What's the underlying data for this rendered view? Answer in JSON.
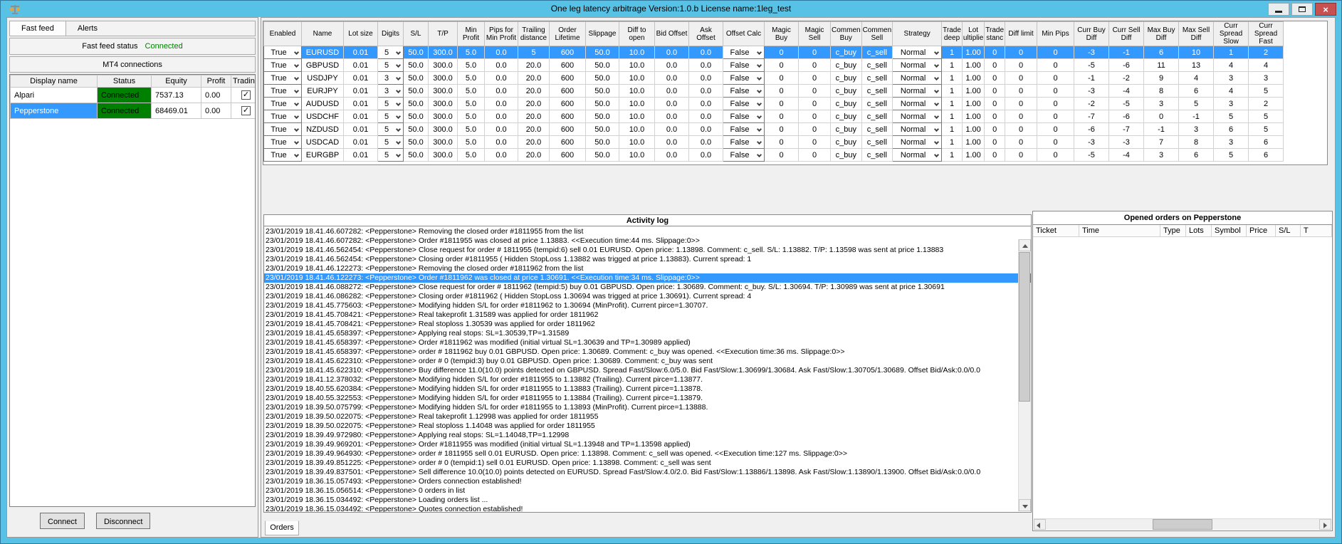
{
  "window": {
    "title": "One leg latency arbitrage Version:1.0.b License name:1leg_test"
  },
  "left_panel": {
    "tabs": [
      {
        "label": "Fast feed",
        "selected": true
      },
      {
        "label": "Alerts",
        "selected": false
      }
    ],
    "fast_feed_status_label": "Fast feed status",
    "fast_feed_status_value": "Connected",
    "mt4_connections_label": "MT4 connections",
    "connections_table": {
      "headers": [
        "Display name",
        "Status",
        "Equity",
        "Profit",
        "Trading"
      ],
      "rows": [
        {
          "display_name": "Alpari",
          "status": "Connected",
          "equity": "7537.13",
          "profit": "0.00",
          "trading_checked": true,
          "selected": false
        },
        {
          "display_name": "Pepperstone",
          "status": "Connected",
          "equity": "68469.01",
          "profit": "0.00",
          "trading_checked": true,
          "selected": true
        }
      ]
    },
    "connect_button": "Connect",
    "disconnect_button": "Disconnect"
  },
  "symbols_grid": {
    "columns": [
      "Enabled",
      "Name",
      "Lot size",
      "Digits",
      "S/L",
      "T/P",
      "Min Profit",
      "Pips for Min Profit",
      "Trailing distance",
      "Order Lifetime",
      "Slippage",
      "Diff to open",
      "Bid Offset",
      "Ask Offset",
      "Offset Calc",
      "Magic Buy",
      "Magic Sell",
      "Commen Buy",
      "Commen Sell",
      "Strategy",
      "Trade deep",
      "Lot ultiplie",
      "Trade stanc",
      "Diff limit",
      "Min Pips",
      "Curr Buy Diff",
      "Curr Sell Diff",
      "Max Buy Diff",
      "Max Sell Diff",
      "Curr Spread Slow",
      "Curr Spread Fast"
    ],
    "combo_columns": [
      0,
      3,
      14,
      19
    ],
    "selected_row": 0,
    "rows": [
      [
        "True",
        "EURUSD",
        "0.01",
        "5",
        "50.0",
        "300.0",
        "5.0",
        "0.0",
        "5",
        "600",
        "50.0",
        "10.0",
        "0.0",
        "0.0",
        "False",
        "0",
        "0",
        "c_buy",
        "c_sell",
        "Normal",
        "1",
        "1.00",
        "0",
        "0",
        "0",
        "-3",
        "-1",
        "6",
        "10",
        "1",
        "2"
      ],
      [
        "True",
        "GBPUSD",
        "0.01",
        "5",
        "50.0",
        "300.0",
        "5.0",
        "0.0",
        "20.0",
        "600",
        "50.0",
        "10.0",
        "0.0",
        "0.0",
        "False",
        "0",
        "0",
        "c_buy",
        "c_sell",
        "Normal",
        "1",
        "1.00",
        "0",
        "0",
        "0",
        "-5",
        "-6",
        "11",
        "13",
        "4",
        "4"
      ],
      [
        "True",
        "USDJPY",
        "0.01",
        "3",
        "50.0",
        "300.0",
        "5.0",
        "0.0",
        "20.0",
        "600",
        "50.0",
        "10.0",
        "0.0",
        "0.0",
        "False",
        "0",
        "0",
        "c_buy",
        "c_sell",
        "Normal",
        "1",
        "1.00",
        "0",
        "0",
        "0",
        "-1",
        "-2",
        "9",
        "4",
        "3",
        "3"
      ],
      [
        "True",
        "EURJPY",
        "0.01",
        "3",
        "50.0",
        "300.0",
        "5.0",
        "0.0",
        "20.0",
        "600",
        "50.0",
        "10.0",
        "0.0",
        "0.0",
        "False",
        "0",
        "0",
        "c_buy",
        "c_sell",
        "Normal",
        "1",
        "1.00",
        "0",
        "0",
        "0",
        "-3",
        "-4",
        "8",
        "6",
        "4",
        "5"
      ],
      [
        "True",
        "AUDUSD",
        "0.01",
        "5",
        "50.0",
        "300.0",
        "5.0",
        "0.0",
        "20.0",
        "600",
        "50.0",
        "10.0",
        "0.0",
        "0.0",
        "False",
        "0",
        "0",
        "c_buy",
        "c_sell",
        "Normal",
        "1",
        "1.00",
        "0",
        "0",
        "0",
        "-2",
        "-5",
        "3",
        "5",
        "3",
        "2"
      ],
      [
        "True",
        "USDCHF",
        "0.01",
        "5",
        "50.0",
        "300.0",
        "5.0",
        "0.0",
        "20.0",
        "600",
        "50.0",
        "10.0",
        "0.0",
        "0.0",
        "False",
        "0",
        "0",
        "c_buy",
        "c_sell",
        "Normal",
        "1",
        "1.00",
        "0",
        "0",
        "0",
        "-7",
        "-6",
        "0",
        "-1",
        "5",
        "5"
      ],
      [
        "True",
        "NZDUSD",
        "0.01",
        "5",
        "50.0",
        "300.0",
        "5.0",
        "0.0",
        "20.0",
        "600",
        "50.0",
        "10.0",
        "0.0",
        "0.0",
        "False",
        "0",
        "0",
        "c_buy",
        "c_sell",
        "Normal",
        "1",
        "1.00",
        "0",
        "0",
        "0",
        "-6",
        "-7",
        "-1",
        "3",
        "6",
        "5"
      ],
      [
        "True",
        "USDCAD",
        "0.01",
        "5",
        "50.0",
        "300.0",
        "5.0",
        "0.0",
        "20.0",
        "600",
        "50.0",
        "10.0",
        "0.0",
        "0.0",
        "False",
        "0",
        "0",
        "c_buy",
        "c_sell",
        "Normal",
        "1",
        "1.00",
        "0",
        "0",
        "0",
        "-3",
        "-3",
        "7",
        "8",
        "3",
        "6"
      ],
      [
        "True",
        "EURGBP",
        "0.01",
        "5",
        "50.0",
        "300.0",
        "5.0",
        "0.0",
        "20.0",
        "600",
        "50.0",
        "10.0",
        "0.0",
        "0.0",
        "False",
        "0",
        "0",
        "c_buy",
        "c_sell",
        "Normal",
        "1",
        "1.00",
        "0",
        "0",
        "0",
        "-5",
        "-4",
        "3",
        "6",
        "5",
        "6"
      ]
    ]
  },
  "activity_log": {
    "title": "Activity log",
    "selected_index": 5,
    "lines": [
      "23/01/2019 18.41.46.607282: <Pepperstone> Removing the closed order #1811955 from the list",
      "23/01/2019 18.41.46.607282: <Pepperstone> Order #1811955 was closed at price 1.13883. <<Execution time:44 ms. Slippage:0>>",
      "23/01/2019 18.41.46.562454: <Pepperstone> Close request for order # 1811955 (tempid:6) sell 0.01 EURUSD. Open price: 1.13898. Comment: c_sell. S/L: 1.13882. T/P: 1.13598 was sent at price 1.13883",
      "23/01/2019 18.41.46.562454: <Pepperstone> Closing order #1811955 ( Hidden StopLoss 1.13882 was trigged at price 1.13883). Current spread: 1",
      "23/01/2019 18.41.46.122273: <Pepperstone> Removing the closed order #1811962 from the list",
      "23/01/2019 18.41.46.122273: <Pepperstone> Order #1811962 was closed at price 1.30691. <<Execution time:34 ms. Slippage:0>>",
      "23/01/2019 18.41.46.088272: <Pepperstone> Close request for order # 1811962 (tempid:5) buy 0.01 GBPUSD. Open price: 1.30689. Comment: c_buy. S/L: 1.30694. T/P: 1.30989 was sent at price 1.30691",
      "23/01/2019 18.41.46.086282: <Pepperstone> Closing order #1811962 ( Hidden StopLoss 1.30694 was trigged at price 1.30691). Current spread: 4",
      "23/01/2019 18.41.45.775603: <Pepperstone> Modifying hidden S/L for order #1811962 to 1.30694 (MinProfit). Current pirce=1.30707.",
      "23/01/2019 18.41.45.708421: <Pepperstone> Real takeprofit 1.31589 was applied for order 1811962",
      "23/01/2019 18.41.45.708421: <Pepperstone> Real stoploss 1.30539 was applied for order 1811962",
      "23/01/2019 18.41.45.658397: <Pepperstone> Applying real stops: SL=1.30539,TP=1.31589",
      "23/01/2019 18.41.45.658397: <Pepperstone> Order #1811962 was modified (initial virtual SL=1.30639 and TP=1.30989 applied)",
      "23/01/2019 18.41.45.658397: <Pepperstone> order # 1811962 buy 0.01 GBPUSD. Open price: 1.30689. Comment: c_buy was opened. <<Execution time:36 ms. Slippage:0>>",
      "23/01/2019 18.41.45.622310: <Pepperstone> order # 0 (tempid:3) buy 0.01 GBPUSD. Open price: 1.30689. Comment: c_buy was sent",
      "23/01/2019 18.41.45.622310: <Pepperstone> Buy difference 11.0(10.0) points detected on GBPUSD. Spread Fast/Slow:6.0/5.0. Bid Fast/Slow:1.30699/1.30684. Ask Fast/Slow:1.30705/1.30689. Offset Bid/Ask:0.0/0.0",
      "23/01/2019 18.41.12.378032: <Pepperstone> Modifying hidden S/L for order #1811955 to 1.13882 (Trailing). Current pirce=1.13877.",
      "23/01/2019 18.40.55.620384: <Pepperstone> Modifying hidden S/L for order #1811955 to 1.13883 (Trailing). Current pirce=1.13878.",
      "23/01/2019 18.40.55.322553: <Pepperstone> Modifying hidden S/L for order #1811955 to 1.13884 (Trailing). Current pirce=1.13879.",
      "23/01/2019 18.39.50.075799: <Pepperstone> Modifying hidden S/L for order #1811955 to 1.13893 (MinProfit). Current pirce=1.13888.",
      "23/01/2019 18.39.50.022075: <Pepperstone> Real takeprofit 1.12998 was applied for order 1811955",
      "23/01/2019 18.39.50.022075: <Pepperstone> Real stoploss 1.14048 was applied for order 1811955",
      "23/01/2019 18.39.49.972980: <Pepperstone> Applying real stops: SL=1.14048,TP=1.12998",
      "23/01/2019 18.39.49.969201: <Pepperstone> Order #1811955 was modified (initial virtual SL=1.13948 and TP=1.13598 applied)",
      "23/01/2019 18.39.49.964930: <Pepperstone> order # 1811955 sell 0.01 EURUSD. Open price: 1.13898. Comment: c_sell was opened. <<Execution time:127 ms. Slippage:0>>",
      "23/01/2019 18.39.49.851225: <Pepperstone> order # 0 (tempid:1) sell 0.01 EURUSD. Open price: 1.13898. Comment: c_sell was sent",
      "23/01/2019 18.39.49.837501: <Pepperstone> Sell difference 10.0(10.0) points detected on EURUSD. Spread Fast/Slow:4.0/2.0. Bid Fast/Slow:1.13886/1.13898. Ask Fast/Slow:1.13890/1.13900. Offset Bid/Ask:0.0/0.0",
      "23/01/2019 18.36.15.057493: <Pepperstone> Orders connection established!",
      "23/01/2019 18.36.15.056514: <Pepperstone> 0 orders in list",
      "23/01/2019 18.36.15.034492: <Pepperstone> Loading orders list ...",
      "23/01/2019 18.36.15.034492: <Pepperstone> Quotes connection established!"
    ]
  },
  "opened_orders": {
    "title": "Opened orders on Pepperstone",
    "headers": [
      "Ticket",
      "Time",
      "Type",
      "Lots",
      "Symbol",
      "Price",
      "S/L",
      "T"
    ]
  },
  "bottom_tabs": {
    "orders": "Orders"
  },
  "colors": {
    "frame": "#58C2E6",
    "selection": "#3399FF",
    "connected_green": "#008000",
    "close_button": "#C75050"
  }
}
